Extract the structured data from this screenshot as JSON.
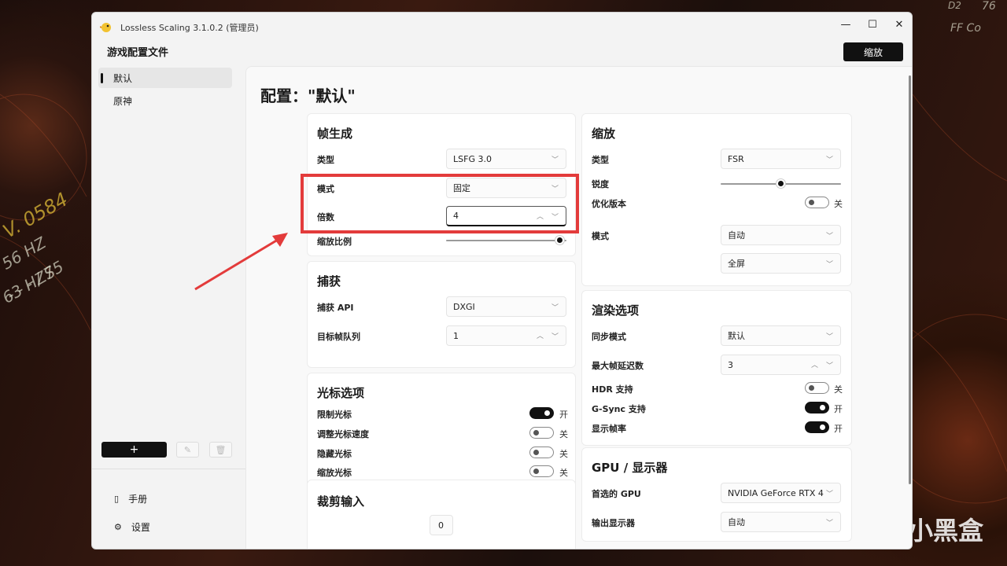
{
  "app": {
    "title": "Lossless Scaling 3.1.0.2 (管理员)"
  },
  "window_controls": {
    "minimize": "—",
    "maximize": "☐",
    "close": "✕"
  },
  "sidebar": {
    "title": "游戏配置文件",
    "profiles": [
      "默认",
      "原神"
    ],
    "add_label": "+",
    "nav": [
      {
        "label": "手册",
        "icon": "book-icon"
      },
      {
        "label": "设置",
        "icon": "gear-icon"
      }
    ]
  },
  "header": {
    "scale_button": "缩放",
    "page_title": "配置：\"默认\""
  },
  "frame_gen": {
    "title": "帧生成",
    "type_label": "类型",
    "type_value": "LSFG 3.0",
    "mode_label": "模式",
    "mode_value": "固定",
    "multiplier_label": "倍数",
    "multiplier_value": "4",
    "scale_ratio_label": "缩放比例",
    "scale_ratio_level": 0.95
  },
  "capture": {
    "title": "捕获",
    "api_label": "捕获 API",
    "api_value": "DXGI",
    "queue_label": "目标帧队列",
    "queue_value": "1"
  },
  "cursor": {
    "title": "光标选项",
    "items": [
      {
        "label": "限制光标",
        "state": "开",
        "on": true
      },
      {
        "label": "调整光标速度",
        "state": "关",
        "on": false
      },
      {
        "label": "隐藏光标",
        "state": "关",
        "on": false
      },
      {
        "label": "缩放光标",
        "state": "关",
        "on": false
      }
    ]
  },
  "crop": {
    "title": "裁剪输入",
    "value": "0"
  },
  "scaling": {
    "title": "缩放",
    "type_label": "类型",
    "type_value": "FSR",
    "sharpness_label": "锐度",
    "sharpness_level": 0.5,
    "optimized_label": "优化版本",
    "optimized_state": "关",
    "mode_label": "模式",
    "mode_value": "自动",
    "mode_value2": "全屏"
  },
  "render": {
    "title": "渲染选项",
    "sync_label": "同步模式",
    "sync_value": "默认",
    "latency_label": "最大帧延迟数",
    "latency_value": "3",
    "hdr_label": "HDR 支持",
    "hdr_state": "关",
    "gsync_label": "G-Sync 支持",
    "gsync_state": "开",
    "fps_label": "显示帧率",
    "fps_state": "开"
  },
  "gpu": {
    "title": "GPU / 显示器",
    "gpu_label": "首选的 GPU",
    "gpu_value": "NVIDIA GeForce RTX 4",
    "display_label": "输出显示器",
    "display_value": "自动"
  },
  "background": {
    "texts": [
      "V. 0584",
      "56 HZ",
      "63 HZS",
      "- - - / 75",
      "FF Co",
      "76",
      "D2"
    ],
    "watermark": "小黑盒"
  },
  "colors": {
    "accent": "#111111",
    "highlight": "#e33b3b"
  }
}
